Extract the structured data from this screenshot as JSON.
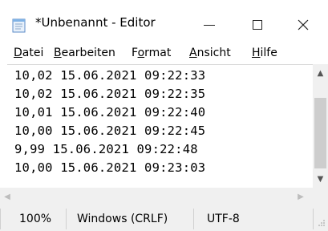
{
  "window": {
    "title": "*Unbenannt - Editor",
    "controls": {
      "minimize": "—",
      "maximize": "□",
      "close": "✕"
    }
  },
  "icons": {
    "app": "notepad-icon",
    "scroll_up": "▲",
    "scroll_down": "▼",
    "scroll_left": "◀",
    "scroll_right": "▶"
  },
  "menu": [
    {
      "label": "Datei",
      "accel": "D",
      "rest": "atei"
    },
    {
      "label": "Bearbeiten",
      "accel": "B",
      "rest": "earbeiten"
    },
    {
      "label": "Format",
      "pre": "F",
      "accel": "o",
      "rest": "rmat"
    },
    {
      "label": "Ansicht",
      "accel": "A",
      "rest": "nsicht"
    },
    {
      "label": "Hilfe",
      "accel": "H",
      "rest": "ilfe"
    }
  ],
  "editor": {
    "lines": [
      "10,02 15.06.2021 09:22:33",
      "10,02 15.06.2021 09:22:35",
      "10,01 15.06.2021 09:22:40",
      "10,00 15.06.2021 09:22:45",
      "9,99 15.06.2021 09:22:48",
      "10,00 15.06.2021 09:23:03"
    ]
  },
  "status": {
    "zoom": "100%",
    "line_endings": "Windows (CRLF)",
    "encoding": "UTF-8"
  },
  "colors": {
    "chrome": "#f0f0f0",
    "text": "#000000",
    "scroll_thumb": "#cdcdcd"
  }
}
